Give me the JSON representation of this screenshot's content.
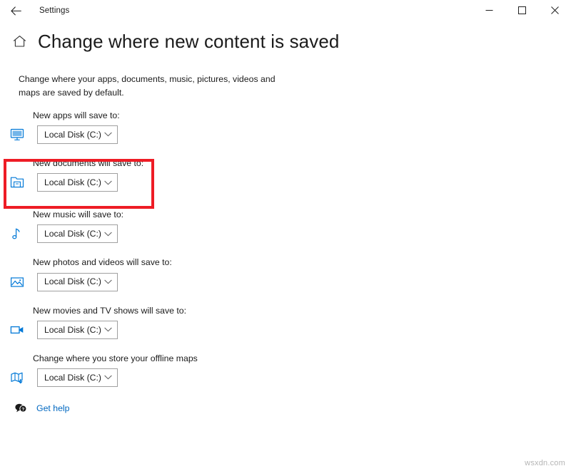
{
  "titlebar": {
    "back_icon": "back-arrow-icon",
    "app_title": "Settings",
    "minimize_label": "–",
    "maximize_label": "□",
    "close_label": "✕"
  },
  "header": {
    "home_icon": "home-icon",
    "title": "Change where new content is saved"
  },
  "description": "Change where your apps, documents, music, pictures, videos and maps are saved by default.",
  "settings_rows": [
    {
      "icon": "monitor-icon",
      "label": "New apps will save to:",
      "value": "Local Disk (C:)"
    },
    {
      "icon": "folder-icon",
      "label": "New documents will save to:",
      "value": "Local Disk (C:)"
    },
    {
      "icon": "music-note-icon",
      "label": "New music will save to:",
      "value": "Local Disk (C:)"
    },
    {
      "icon": "picture-icon",
      "label": "New photos and videos will save to:",
      "value": "Local Disk (C:)"
    },
    {
      "icon": "video-camera-icon",
      "label": "New movies and TV shows will save to:",
      "value": "Local Disk (C:)"
    },
    {
      "icon": "map-download-icon",
      "label": "Change where you store your offline maps",
      "value": "Local Disk (C:)"
    }
  ],
  "highlight": {
    "color": "#ee1c25",
    "target_row_index": 1
  },
  "footer": {
    "help_icon": "help-bubble-icon",
    "help_label": "Get help"
  },
  "watermark": "wsxdn.com",
  "colors": {
    "accent": "#0078d7",
    "link": "#0067c0",
    "text": "#1b1b1b",
    "border": "#a0a0a0",
    "highlight": "#ee1c25"
  }
}
